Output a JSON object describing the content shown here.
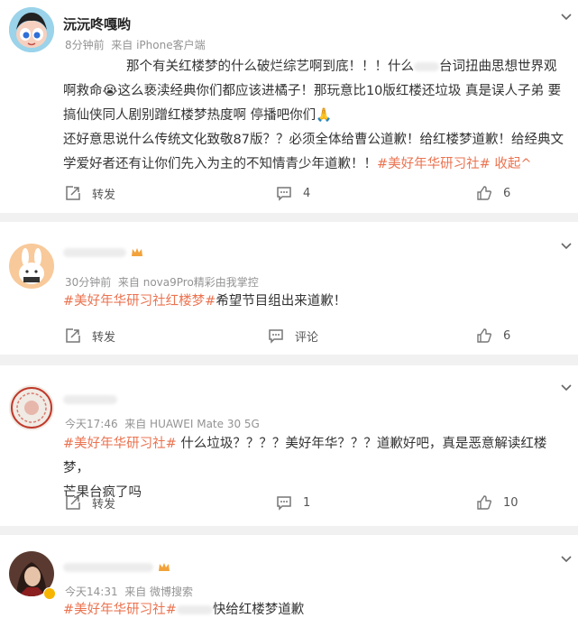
{
  "posts": [
    {
      "user": "沅沅咚嘎哟",
      "time": "8分钟前",
      "source": "来自 iPhone客户端",
      "line1": "那个有关红楼梦的什么破烂综艺啊到底！！！什么",
      "line1b": "台词扭曲思想世界观",
      "line2": "啊救命😭这么亵渎经典你们都应该进橘子！那玩意比10版红楼还垃圾 真是误人子弟 要",
      "line3": "搞仙侠同人剧别蹭红楼梦热度啊 停播吧你们🙏",
      "line4": "还好意思说什么传统文化致敬87版？？必须全体给曹公道歉！给红楼梦道歉！给经典文",
      "line5": "学爱好者还有让你们先入为主的不知情青少年道歉！！",
      "hashtag": "#美好年华研习社#",
      "collapse": "收起",
      "repost_label": "转发",
      "comment_count": "4",
      "like_count": "6"
    },
    {
      "time": "30分钟前",
      "source": "来自 nova9Pro精彩由我掌控",
      "hashtag": "#美好年华研习社红楼梦#",
      "text": "希望节目组出来道歉！",
      "repost_label": "转发",
      "comment_label": "评论",
      "like_count": "6"
    },
    {
      "time": "今天17:46",
      "source": "来自 HUAWEI Mate 30 5G",
      "hashtag": "#美好年华研习社#",
      "line1": " 什么垃圾？？？？美好年华？？？道歉好吧，真是恶意解读红楼梦，",
      "line2": "芒果台疯了吗",
      "repost_label": "转发",
      "comment_count": "1",
      "like_count": "10"
    },
    {
      "time": "今天14:31",
      "source": "来自 微博搜索",
      "hashtag": "#美好年华研习社#",
      "text": "快给红楼梦道歉"
    }
  ],
  "colors": {
    "accent": "#eb7350",
    "meta": "#939393",
    "icon": "#777777"
  }
}
